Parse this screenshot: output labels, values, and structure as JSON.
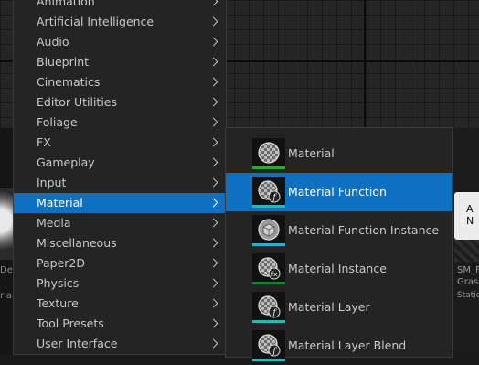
{
  "main_menu": {
    "items": [
      {
        "label": "Animation",
        "active": false
      },
      {
        "label": "Artificial Intelligence",
        "active": false
      },
      {
        "label": "Audio",
        "active": false
      },
      {
        "label": "Blueprint",
        "active": false
      },
      {
        "label": "Cinematics",
        "active": false
      },
      {
        "label": "Editor Utilities",
        "active": false
      },
      {
        "label": "Foliage",
        "active": false
      },
      {
        "label": "FX",
        "active": false
      },
      {
        "label": "Gameplay",
        "active": false
      },
      {
        "label": "Input",
        "active": false
      },
      {
        "label": "Material",
        "active": true
      },
      {
        "label": "Media",
        "active": false
      },
      {
        "label": "Miscellaneous",
        "active": false
      },
      {
        "label": "Paper2D",
        "active": false
      },
      {
        "label": "Physics",
        "active": false
      },
      {
        "label": "Texture",
        "active": false
      },
      {
        "label": "Tool Presets",
        "active": false
      },
      {
        "label": "User Interface",
        "active": false
      }
    ]
  },
  "sub_menu": {
    "items": [
      {
        "label": "Material",
        "icon": "material-sphere-icon",
        "accent": "#2ea82e",
        "active": false
      },
      {
        "label": "Material Function",
        "icon": "material-function-icon",
        "accent": "#2bb3c4",
        "active": true
      },
      {
        "label": "Material Function Instance",
        "icon": "material-function-instance-icon",
        "accent": "#2bb3c4",
        "active": false
      },
      {
        "label": "Material Instance",
        "icon": "material-instance-icon",
        "accent": "#1f7f2a",
        "active": false
      },
      {
        "label": "Material Layer",
        "icon": "material-layer-icon",
        "accent": "#2bb3c4",
        "active": false
      },
      {
        "label": "Material Layer Blend",
        "icon": "material-layer-blend-icon",
        "accent": "#2bb3c4",
        "active": false
      }
    ]
  },
  "background": {
    "left_label_1": "Dev",
    "left_label_2": "rial",
    "right_thumbnail_text": "A N",
    "right_label_1": "SM_F",
    "right_label_2": "Grass",
    "right_label_3": "Static"
  },
  "colors": {
    "highlight": "#0e70c0",
    "menu_bg": "#242424",
    "text": "#c8c8c8"
  }
}
